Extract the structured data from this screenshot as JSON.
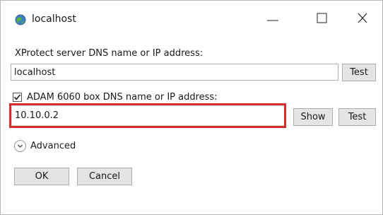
{
  "window": {
    "title": "localhost",
    "controls": {
      "minimize": "minimize",
      "maximize": "maximize",
      "close": "close"
    }
  },
  "form": {
    "server_label": "XProtect server DNS name or IP address:",
    "server_value": "localhost",
    "server_test_label": "Test",
    "adam_checkbox_checked": true,
    "adam_label": "ADAM 6060 box DNS name or IP address:",
    "adam_value": "10.10.0.2",
    "show_label": "Show",
    "adam_test_label": "Test",
    "advanced_label": "Advanced"
  },
  "actions": {
    "ok_label": "OK",
    "cancel_label": "Cancel"
  },
  "colors": {
    "highlight": "#d2302b",
    "button_bg": "#e4e4e4",
    "border": "#b2b2b2"
  },
  "icons": {
    "app": "globe-icon",
    "check": "checkmark-icon",
    "expander": "chevron-down-icon"
  }
}
